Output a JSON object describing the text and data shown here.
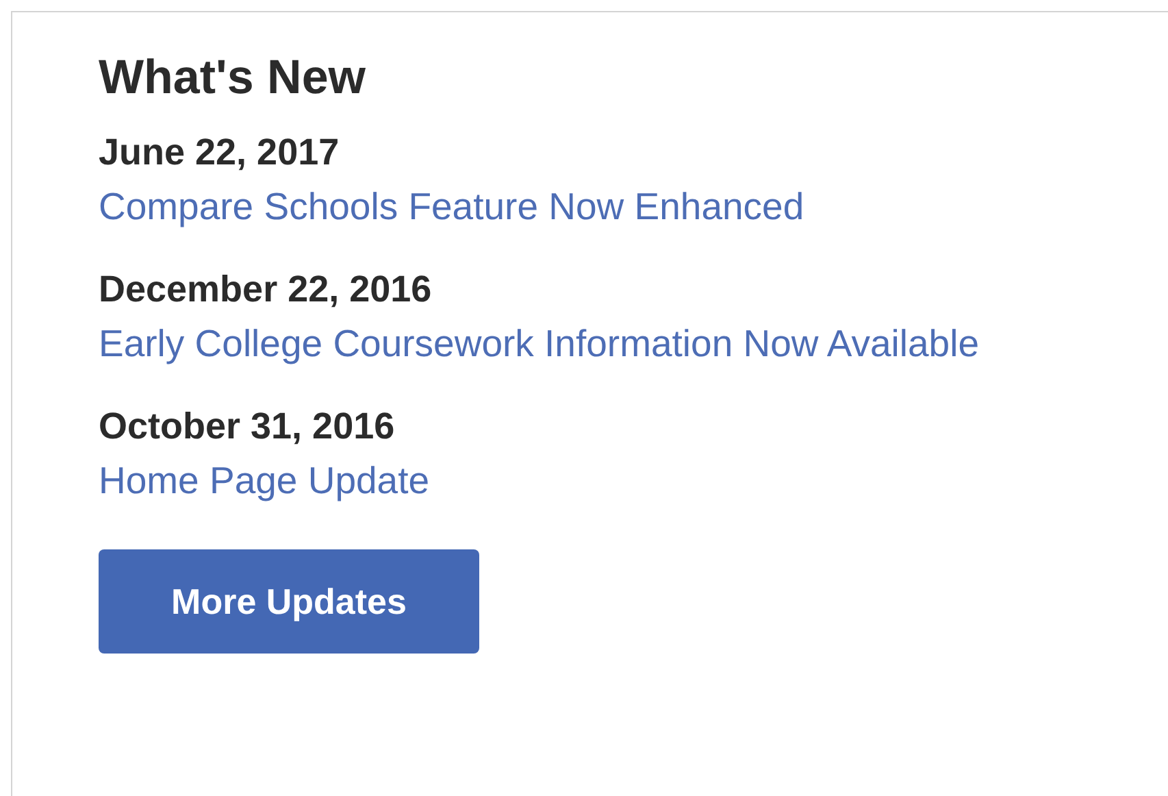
{
  "title": "What's New",
  "updates": [
    {
      "date": "June 22, 2017",
      "link": "Compare Schools Feature Now Enhanced"
    },
    {
      "date": "December 22, 2016",
      "link": "Early College Coursework Information Now Available"
    },
    {
      "date": "October 31, 2016",
      "link": "Home Page Update"
    }
  ],
  "button": "More Updates"
}
